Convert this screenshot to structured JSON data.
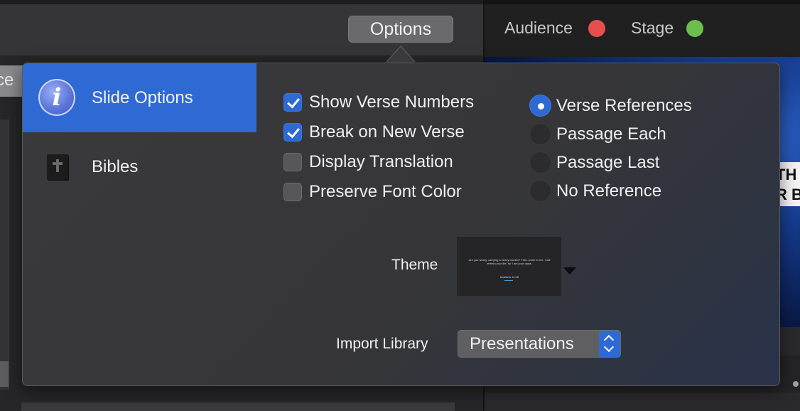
{
  "toolbar": {
    "options_label": "Options"
  },
  "left_tab": {
    "label": "ce"
  },
  "screens": {
    "audience": {
      "label": "Audience",
      "status_color": "#e94e4e"
    },
    "stage": {
      "label": "Stage",
      "status_color": "#6cbf4f"
    }
  },
  "preview": {
    "text_fragment_1": "TH",
    "text_fragment_2": "R B"
  },
  "popover": {
    "sidebar": [
      {
        "label": "Slide Options",
        "icon": "info-icon",
        "selected": true
      },
      {
        "label": "Bibles",
        "icon": "bible-icon",
        "selected": false
      }
    ],
    "checkboxes": [
      {
        "label": "Show Verse Numbers",
        "checked": true
      },
      {
        "label": "Break on New Verse",
        "checked": true
      },
      {
        "label": "Display Translation",
        "checked": false
      },
      {
        "label": "Preserve Font Color",
        "checked": false
      }
    ],
    "reference_options": [
      {
        "label": "Verse References",
        "selected": true
      },
      {
        "label": "Passage Each",
        "selected": false
      },
      {
        "label": "Passage Last",
        "selected": false
      },
      {
        "label": "No Reference",
        "selected": false
      }
    ],
    "theme": {
      "label": "Theme",
      "thumbnail_text": "Are you weary, carrying a heavy burden? Then come to me. I will refresh your life, for I am your oasis.",
      "thumbnail_reference": "Matthew 11:28"
    },
    "import_library": {
      "label": "Import Library",
      "value": "Presentations"
    }
  },
  "colors": {
    "accent": "#2f6ad4",
    "popover_bg": "#3a3a3c"
  }
}
